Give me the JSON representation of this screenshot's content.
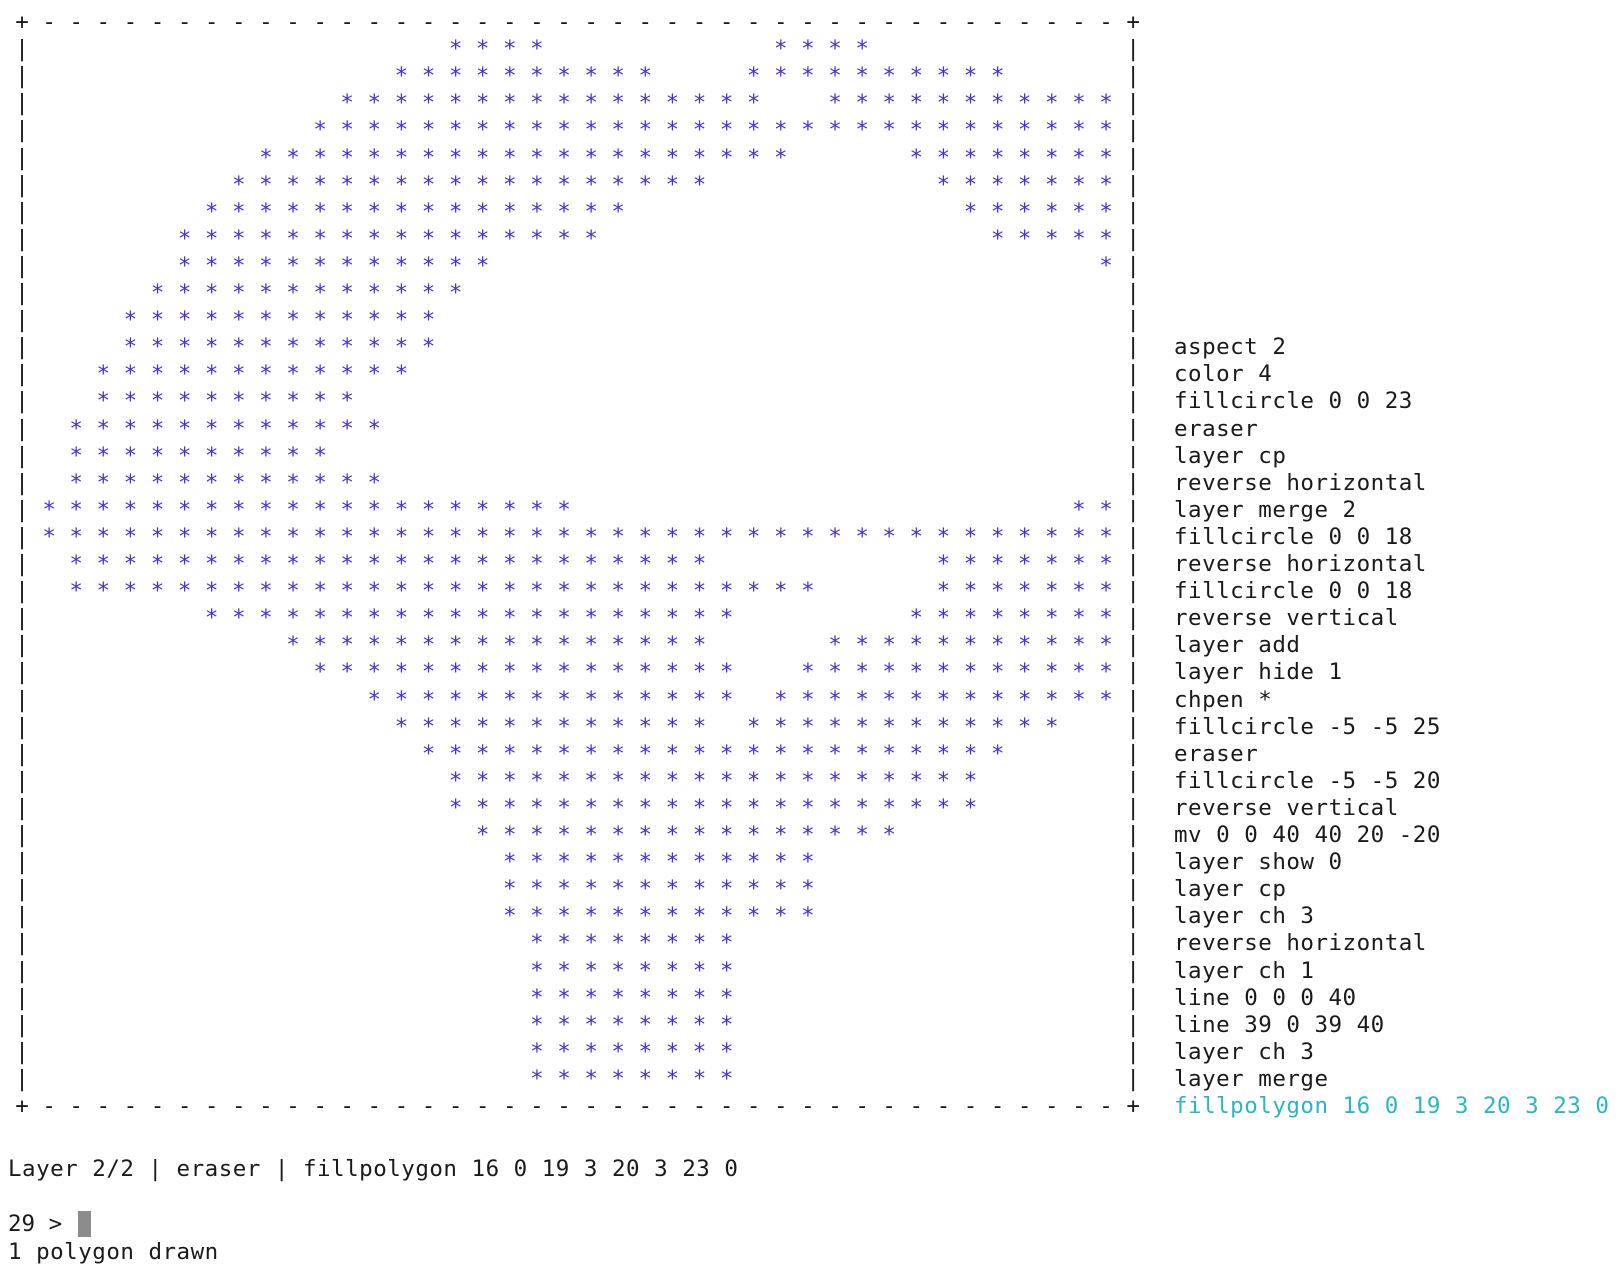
{
  "colors": {
    "frame": "#1a1a1a",
    "pen": "#4b2fd6",
    "history_current": "#2bb6c4",
    "cursor": "#8c8c8c"
  },
  "canvas": {
    "rows": [
      "",
      "               ****        ****",
      "             **********   **********",
      "           ****************  ****************",
      "          ****************************************",
      "        ********************    ********************",
      "       ******************        ******************",
      "      ****************            ****************",
      "     ****************              ****************",
      "     ************                      ************",
      "    ************                        ************",
      "   ************                          ************",
      "   ************                          ************",
      "  ************                            ************",
      "  **********                                **********",
      " ************                               ************",
      " **********                                   **********",
      " ************                               ************",
      "********************                  ********************",
      "**********************************************************",
      " ************************        ************************",
      " ****************************    ****************************",
      "      ********************      ********************",
      "         ****************    ****************",
      "          ****************  ****************",
      "            ************** **************",
      "             ************ ************",
      "              **********************",
      "               ********************",
      "               ********************",
      "                ****************",
      "                 ************",
      "                 ************",
      "                 ************",
      "                  ********",
      "                  ********",
      "                  ********",
      "                  ********",
      "                  ********",
      "                  ********"
    ]
  },
  "history": [
    "aspect 2",
    "color 4",
    "fillcircle 0 0 23",
    "eraser",
    "layer cp",
    "reverse horizontal",
    "layer merge 2",
    "fillcircle 0 0 18",
    "reverse horizontal",
    "fillcircle 0 0 18",
    "reverse vertical",
    "layer add",
    "layer hide 1",
    "chpen *",
    "fillcircle -5 -5 25",
    "eraser",
    "fillcircle -5 -5 20",
    "reverse vertical",
    "mv 0 0 40 40 20 -20",
    "layer show 0",
    "layer cp",
    "layer ch 3",
    "reverse horizontal",
    "layer ch 1",
    "line 0 0 0 40",
    "line 39 0 39 40",
    "layer ch 3",
    "layer merge"
  ],
  "history_current": "fillpolygon 16 0 19 3 20 3 23 0",
  "status": {
    "line": "Layer 2/2 | eraser | fillpolygon 16 0 19 3 20 3 23 0",
    "prompt": "29 > ",
    "message": "1 polygon drawn"
  }
}
